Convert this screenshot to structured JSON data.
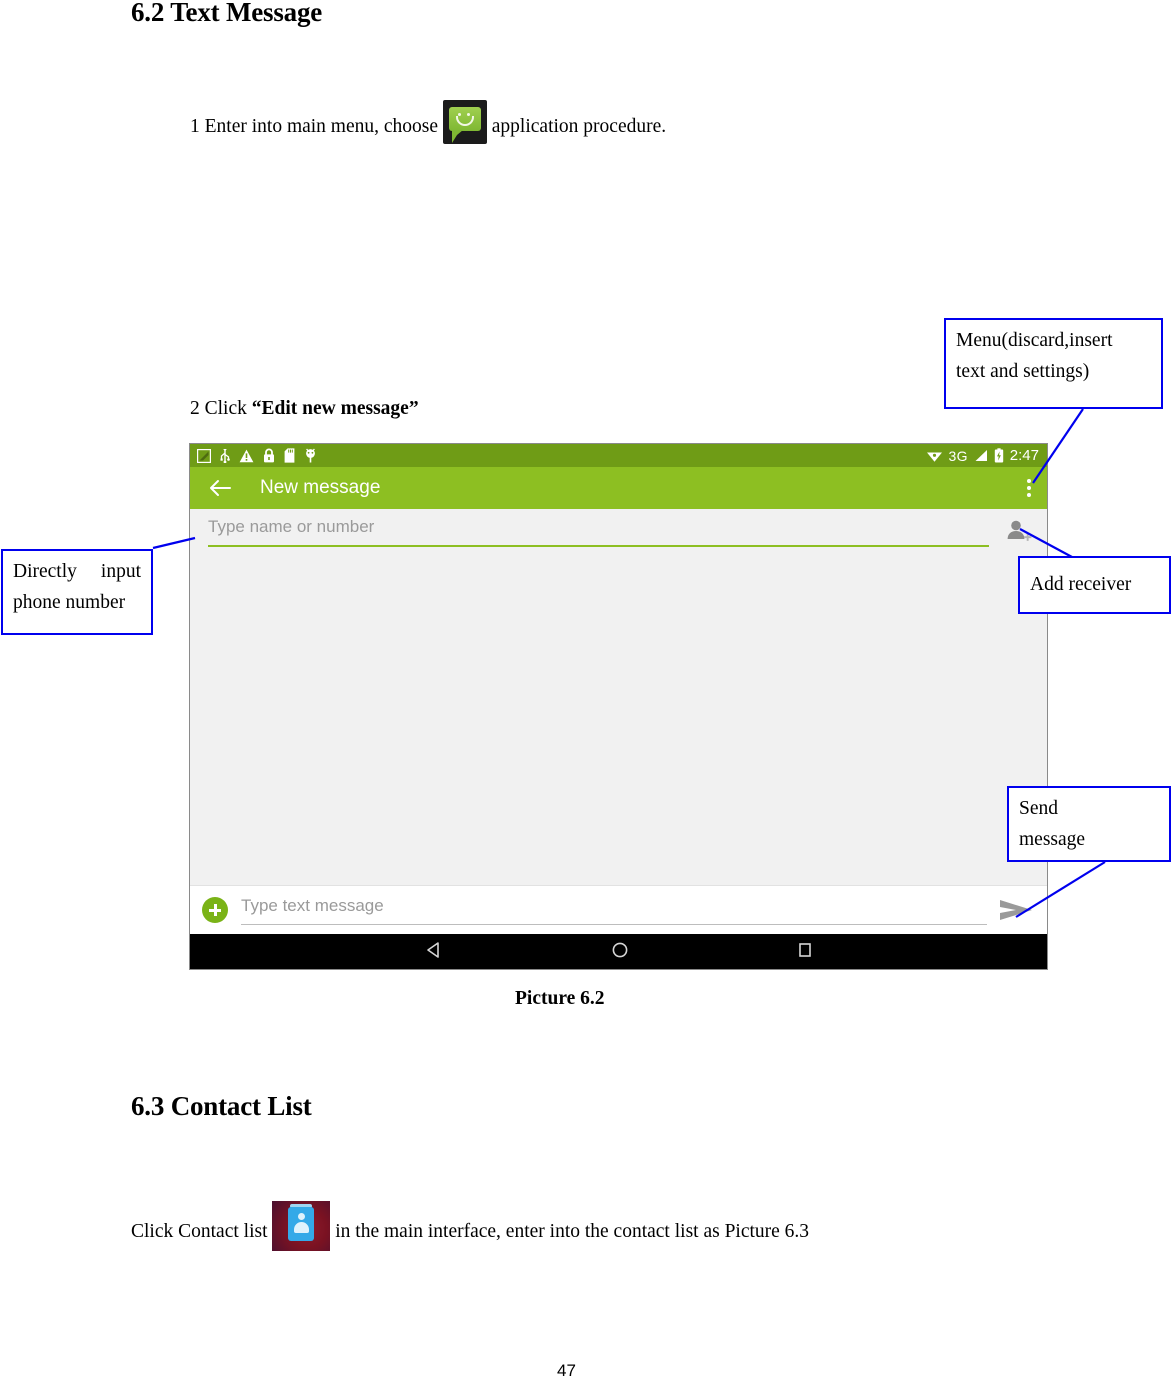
{
  "document": {
    "section_1_title": "6.2 Text Message",
    "step_1_prefix": "1 Enter into main menu, choose",
    "step_1_suffix": "application procedure.",
    "step_1_icon": "sms-app-icon",
    "step_2_prefix": "2 Click",
    "step_2_bold": "“Edit new message”",
    "picture_caption": "Picture 6.2",
    "section_2_title": "6.3 Contact List",
    "contact_line_prefix": "Click Contact list",
    "contact_line_suffix": "in the main interface, enter into the contact list as Picture 6.3",
    "contact_icon": "contacts-app-icon",
    "page_number": "47"
  },
  "callouts": {
    "menu": {
      "line1": "Menu(discard,insert",
      "line2": "text and settings)",
      "border_color": "#0000ee"
    },
    "directly_input": {
      "word1": "Directly",
      "word2": "input",
      "line2": "phone number",
      "border_color": "#0000ee"
    },
    "add_receiver": {
      "label": "Add receiver",
      "border_color": "#0000ee"
    },
    "send_message": {
      "line1": "Send",
      "line2": "message",
      "border_color": "#0000ee"
    }
  },
  "device": {
    "statusbar": {
      "background": "#6f9c16",
      "left_icons": [
        "screenshot-icon",
        "usb-icon",
        "warning-triangle-icon",
        "lock-icon",
        "sd-card-icon",
        "android-debug-icon"
      ],
      "wifi_icon": "wifi-icon",
      "network_label": "3G",
      "signal_icon": "signal-bars-icon",
      "battery_icon": "battery-icon",
      "clock": "2:47"
    },
    "appbar": {
      "background": "#8dbf22",
      "back_icon": "back-arrow-icon",
      "title": "New message",
      "overflow_icon": "overflow-menu-icon"
    },
    "recipient": {
      "placeholder": "Type name or number",
      "value": "",
      "add_contact_icon": "add-person-icon",
      "underline_color": "#8dbf22"
    },
    "conversation": {
      "background": "#f1f1f1",
      "messages": []
    },
    "compose": {
      "attach_icon": "plus-attach-icon",
      "attach_color": "#7ab317",
      "placeholder": "Type text message",
      "value": "",
      "send_icon": "send-arrow-icon"
    },
    "navbar": {
      "background": "#000000",
      "buttons": [
        "back-nav-icon",
        "home-nav-icon",
        "recents-nav-icon"
      ]
    }
  }
}
